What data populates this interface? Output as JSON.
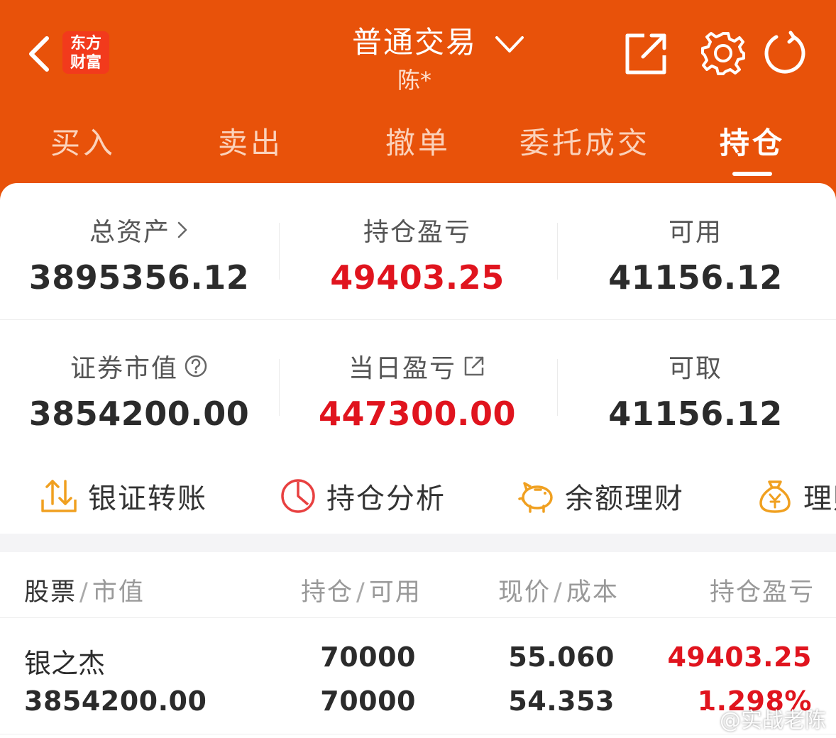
{
  "header": {
    "logo_line1": "东方",
    "logo_line2": "财富",
    "title": "普通交易",
    "account_name": "陈*",
    "brand_color": "#e8520a"
  },
  "tabs": [
    {
      "label": "买入"
    },
    {
      "label": "卖出"
    },
    {
      "label": "撤单"
    },
    {
      "label": "委托成交"
    },
    {
      "label": "持仓",
      "active": true
    }
  ],
  "summary": {
    "total_assets_label": "总资产",
    "total_assets_value": "3895356.12",
    "position_pnl_label": "持仓盈亏",
    "position_pnl_value": "49403.25",
    "available_label": "可用",
    "available_value": "41156.12",
    "market_value_label": "证券市值",
    "market_value_value": "3854200.00",
    "daily_pnl_label": "当日盈亏",
    "daily_pnl_value": "447300.00",
    "withdrawable_label": "可取",
    "withdrawable_value": "41156.12"
  },
  "quick_actions": [
    {
      "label": "银证转账",
      "icon": "transfer-icon"
    },
    {
      "label": "持仓分析",
      "icon": "pie-chart-icon"
    },
    {
      "label": "余额理财",
      "icon": "piggy-bank-icon"
    },
    {
      "label": "理财",
      "icon": "money-bag-icon"
    }
  ],
  "table": {
    "col1_a": "股票",
    "col1_b": "市值",
    "col2_a": "持仓",
    "col2_b": "可用",
    "col3_a": "现价",
    "col3_b": "成本",
    "col4": "持仓盈亏",
    "rows": [
      {
        "name": "银之杰",
        "market_value": "3854200.00",
        "position": "70000",
        "available": "70000",
        "price": "55.060",
        "cost": "54.353",
        "pnl": "49403.25",
        "pnl_pct": "1.298%"
      }
    ]
  },
  "watermark": "@实战老陈"
}
